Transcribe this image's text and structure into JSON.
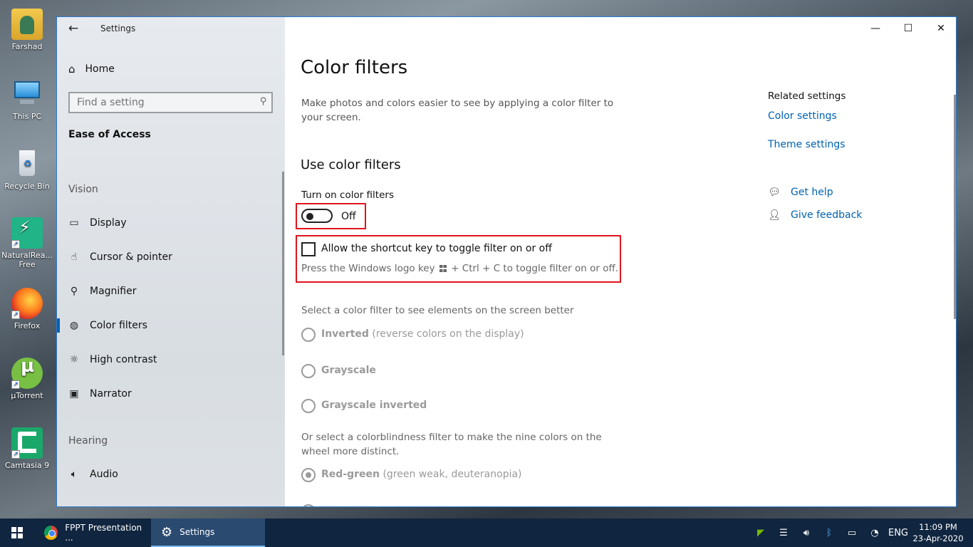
{
  "desktop": {
    "icons": [
      {
        "label": "Farshad",
        "icon": "user-folder-icon"
      },
      {
        "label": "This PC",
        "icon": "computer-icon"
      },
      {
        "label": "Recycle Bin",
        "icon": "recycle-bin-icon"
      },
      {
        "label": "NaturalRea... Free",
        "icon": "naturalreader-icon"
      },
      {
        "label": "Firefox",
        "icon": "firefox-icon"
      },
      {
        "label": "µTorrent",
        "icon": "utorrent-icon"
      },
      {
        "label": "Camtasia 9",
        "icon": "camtasia-icon"
      }
    ]
  },
  "window": {
    "title": "Settings",
    "controls": {
      "minimize": "—",
      "maximize": "☐",
      "close": "✕"
    }
  },
  "sidebar": {
    "home_label": "Home",
    "search": {
      "placeholder": "Find a setting"
    },
    "section": "Ease of Access",
    "groups": [
      {
        "label": "Vision",
        "items": [
          {
            "label": "Display",
            "icon": "display-icon"
          },
          {
            "label": "Cursor & pointer",
            "icon": "cursor-icon"
          },
          {
            "label": "Magnifier",
            "icon": "magnifier-icon"
          },
          {
            "label": "Color filters",
            "icon": "palette-icon",
            "active": true
          },
          {
            "label": "High contrast",
            "icon": "sun-icon"
          },
          {
            "label": "Narrator",
            "icon": "narrator-icon"
          }
        ]
      },
      {
        "label": "Hearing",
        "items": [
          {
            "label": "Audio",
            "icon": "speaker-icon"
          }
        ]
      }
    ]
  },
  "main": {
    "title": "Color filters",
    "description": "Make photos and colors easier to see by applying a color filter to your screen.",
    "subheading": "Use color filters",
    "toggle": {
      "label": "Turn on color filters",
      "state": "Off"
    },
    "shortcut": {
      "label": "Allow the shortcut key to toggle filter on or off",
      "hint_before": "Press the Windows logo key",
      "hint_after": "+ Ctrl + C to toggle filter on or off.",
      "checked": false
    },
    "select_hint": "Select a color filter to see elements on the screen better",
    "filters": [
      {
        "name": "Inverted",
        "detail": "(reverse colors on the display)",
        "checked": false
      },
      {
        "name": "Grayscale",
        "detail": "",
        "checked": false
      },
      {
        "name": "Grayscale inverted",
        "detail": "",
        "checked": false
      }
    ],
    "colorblind_hint": "Or select a colorblindness filter to make the nine colors on the wheel more distinct.",
    "colorblind_filters": [
      {
        "name": "Red-green",
        "detail": "(green weak, deuteranopia)",
        "checked": true
      }
    ],
    "related": {
      "heading": "Related settings",
      "links": [
        "Color settings",
        "Theme settings"
      ]
    },
    "help": [
      {
        "label": "Get help",
        "icon": "help-chat-icon"
      },
      {
        "label": "Give feedback",
        "icon": "feedback-icon"
      }
    ]
  },
  "taskbar": {
    "items": [
      {
        "label": "FPPT Presentation ...",
        "icon": "chrome-icon"
      },
      {
        "label": "Settings",
        "icon": "gear-icon",
        "active": true
      }
    ],
    "language": "ENG",
    "time": "11:09 PM",
    "date": "23-Apr-2020"
  },
  "colors": {
    "accent": "#0063b1",
    "highlight_box": "#e0141e",
    "taskbar": "#10253f"
  }
}
